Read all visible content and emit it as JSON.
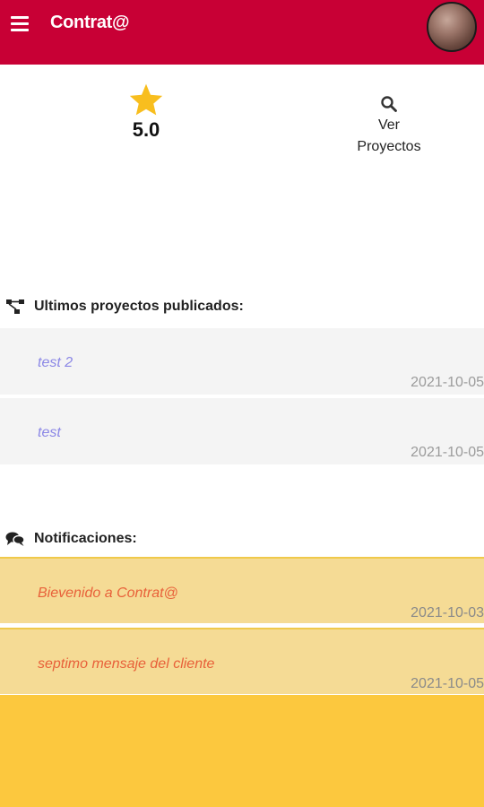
{
  "appbar": {
    "title": "Contrat@",
    "menu_icon": "hamburger-menu-icon",
    "avatar": "user-avatar",
    "color": "#c80035"
  },
  "stats": {
    "rating_value": "5.0",
    "rating_icon": "star-icon",
    "rating_color": "#f8be1e",
    "view_projects_line1": "Ver",
    "view_projects_line2": "Proyectos",
    "view_projects_icon": "search-icon"
  },
  "projects_section": {
    "heading": "Ultimos proyectos publicados:",
    "icon": "hierarchy-icon",
    "items": [
      {
        "title": "test 2",
        "date": "2021-10-05"
      },
      {
        "title": "test",
        "date": "2021-10-05"
      }
    ]
  },
  "notifications_section": {
    "heading": "Notificaciones:",
    "icon": "chat-bubbles-icon",
    "items": [
      {
        "title": "Bievenido a Contrat@",
        "date": "2021-10-03"
      },
      {
        "title": "septimo mensaje del cliente",
        "date": "2021-10-05"
      }
    ]
  }
}
